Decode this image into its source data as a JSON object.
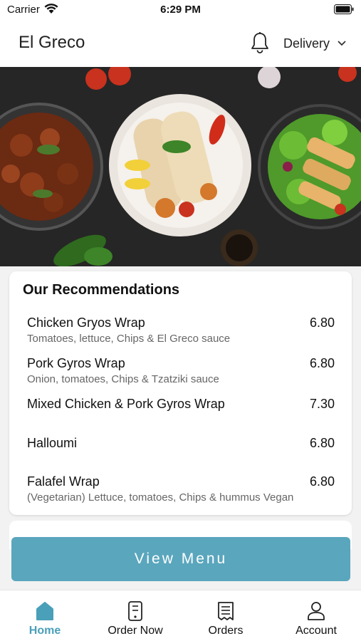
{
  "status_bar": {
    "carrier": "Carrier",
    "time": "6:29 PM"
  },
  "header": {
    "title": "El Greco",
    "delivery_label": "Delivery"
  },
  "recommendations": {
    "title": "Our Recommendations",
    "items": [
      {
        "name": "Chicken Gryos Wrap",
        "price": "6.80",
        "description": "Tomatoes, lettuce, Chips & El Greco sauce"
      },
      {
        "name": "Pork Gyros Wrap",
        "price": "6.80",
        "description": "Onion, tomatoes, Chips & Tzatziki sauce"
      },
      {
        "name": "Mixed Chicken & Pork Gyros Wrap",
        "price": "7.30",
        "description": ""
      },
      {
        "name": "Halloumi",
        "price": "6.80",
        "description": ""
      },
      {
        "name": "Falafel Wrap",
        "price": "6.80",
        "description": "(Vegetarian) Lettuce, tomatoes, Chips & hummus  Vegan"
      }
    ]
  },
  "view_menu_label": "View Menu",
  "tabs": [
    {
      "label": "Home",
      "icon": "home-icon",
      "active": true
    },
    {
      "label": "Order Now",
      "icon": "order-now-icon",
      "active": false
    },
    {
      "label": "Orders",
      "icon": "receipt-icon",
      "active": false
    },
    {
      "label": "Account",
      "icon": "user-icon",
      "active": false
    }
  ],
  "colors": {
    "accent": "#5aa6bd",
    "active_tab": "#4a9fb9"
  }
}
